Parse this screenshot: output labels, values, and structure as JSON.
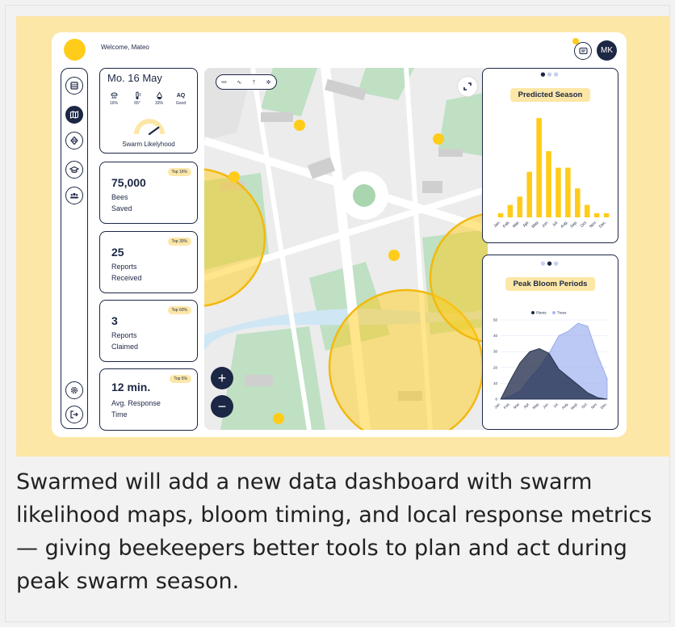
{
  "header": {
    "welcome": "Welcome, Mateo",
    "avatar_initials": "MK"
  },
  "sidebar": {
    "items": [
      {
        "name": "dashboard-icon"
      },
      {
        "name": "map-icon",
        "active": true
      },
      {
        "name": "hive-icon"
      },
      {
        "name": "education-icon"
      },
      {
        "name": "community-icon"
      }
    ],
    "bottom": [
      {
        "name": "settings-icon"
      },
      {
        "name": "logout-icon"
      }
    ]
  },
  "weather": {
    "date": "Mo. 16 May",
    "items": [
      {
        "icon": "rain-icon",
        "value": "16%"
      },
      {
        "icon": "thermometer-icon",
        "value": "65°"
      },
      {
        "icon": "humidity-icon",
        "value": "33%"
      },
      {
        "icon": "air-quality-icon",
        "label": "AQ",
        "value": "Good"
      }
    ],
    "gauge_level": 0.8,
    "label": "Swarm Likelyhood"
  },
  "stats": [
    {
      "value": "75,000",
      "label1": "Bees",
      "label2": "Saved",
      "badge": "Top 16%"
    },
    {
      "value": "25",
      "label1": "Reports",
      "label2": "Received",
      "badge": "Top 30%"
    },
    {
      "value": "3",
      "label1": "Reports",
      "label2": "Claimed",
      "badge": "Top 60%"
    },
    {
      "value": "12 min.",
      "label1": "Avg. Response",
      "label2": "Time",
      "badge": "Top 5%"
    }
  ],
  "map": {
    "zoom_in": "+",
    "zoom_out": "−",
    "tools": [
      "route-icon",
      "pulse-icon",
      "bloom-icon",
      "hive-pattern-icon"
    ]
  },
  "predicted_season": {
    "title": "Predicted Season"
  },
  "peak_bloom": {
    "title": "Peak Bloom Periods"
  },
  "caption": "Swarmed will add a new data dashboard with swarm likelihood maps, bloom timing, and local response metrics — giving beekeepers better tools to plan and act during peak swarm season.",
  "colors": {
    "navy": "#1c2745",
    "yellow": "#ffcc1a",
    "light_yellow": "#fde7a7",
    "trees_blue": "#a9b9f2"
  },
  "chart_data": [
    {
      "type": "bar",
      "title": "Predicted Season",
      "categories": [
        "Jan",
        "Feb",
        "Mar",
        "Apr",
        "May",
        "Jun",
        "Jul",
        "Aug",
        "Sep",
        "Oct",
        "Nov",
        "Dec"
      ],
      "values": [
        1,
        3,
        5,
        11,
        24,
        16,
        12,
        12,
        7,
        3,
        1,
        1
      ],
      "ylim": [
        0,
        25
      ]
    },
    {
      "type": "area",
      "title": "",
      "categories": [
        "Jan",
        "Feb",
        "Mar",
        "Apr",
        "May",
        "Jun",
        "Jul",
        "Aug",
        "Sept",
        "Oct",
        "Nov",
        "Dec"
      ],
      "series": [
        {
          "name": "Plants",
          "values": [
            0,
            12,
            23,
            30,
            32,
            29,
            19,
            14,
            9,
            4,
            1,
            0
          ]
        },
        {
          "name": "Trees",
          "values": [
            0,
            2,
            5,
            13,
            20,
            29,
            40,
            43,
            48,
            46,
            28,
            13
          ]
        }
      ],
      "ylim": [
        0,
        50
      ],
      "yticks": [
        0,
        10,
        20,
        30,
        40,
        50
      ],
      "legend": "top-center"
    }
  ]
}
